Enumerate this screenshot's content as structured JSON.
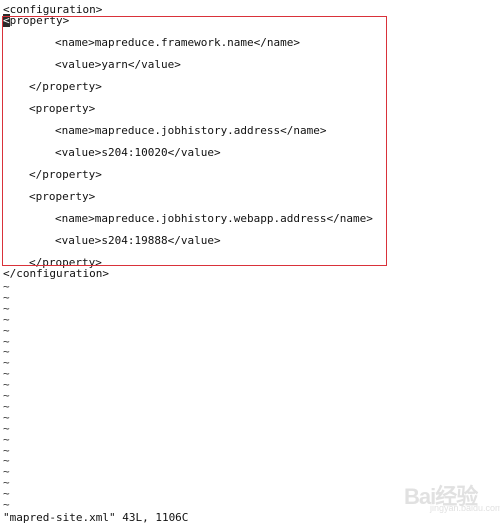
{
  "editor": {
    "lines": {
      "conf_open": "<configuration>",
      "prop1_open_first_char": "<",
      "prop1_open_rest": "property>",
      "name1": "<name>mapreduce.framework.name</name>",
      "val1": "<value>yarn</value>",
      "prop1_close": "</property>",
      "prop2_open": "<property>",
      "name2": "<name>mapreduce.jobhistory.address</name>",
      "val2": "<value>s204:10020</value>",
      "prop2_close": "</property>",
      "prop3_open": "<property>",
      "name3": "<name>mapreduce.jobhistory.webapp.address</name>",
      "val3": "<value>s204:19888</value>",
      "prop3_close": "</property>",
      "conf_close": "</configuration>"
    },
    "empty_line_marker": "~",
    "status_line": "\"mapred-site.xml\" 43L, 1106C"
  },
  "colors": {
    "highlight": "#d9323a",
    "text": "#111111",
    "background": "#ffffff"
  },
  "watermark": {
    "logo_text": "Bai经验",
    "sub_text": "jingyan.baidu.com"
  }
}
